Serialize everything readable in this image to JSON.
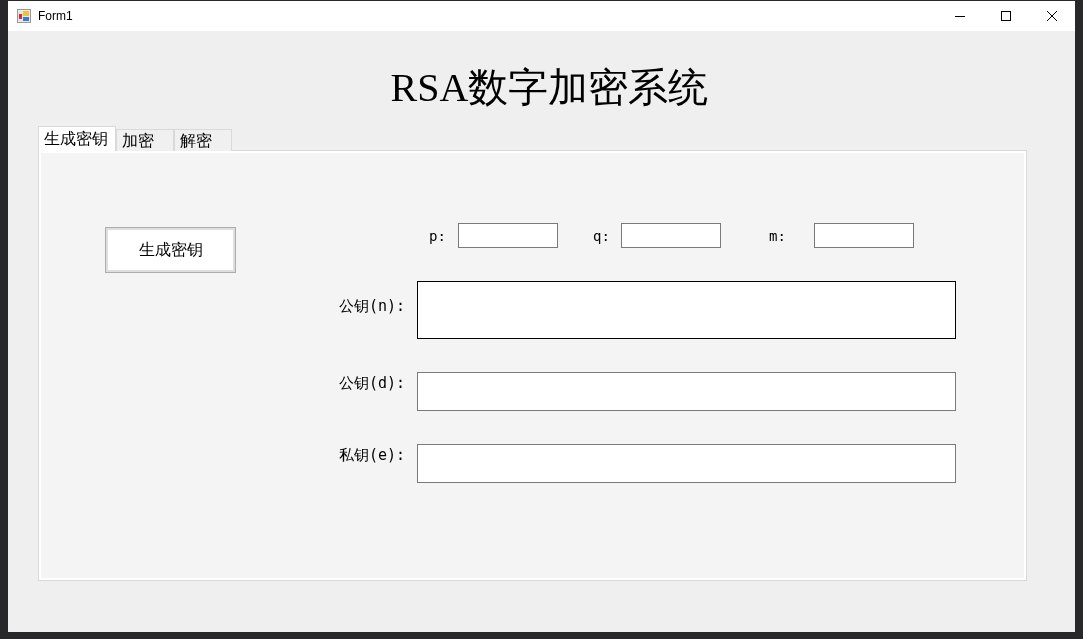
{
  "window": {
    "title": "Form1"
  },
  "heading": "RSA数字加密系统",
  "tabs": [
    {
      "label": "生成密钥",
      "selected": true
    },
    {
      "label": "加密",
      "selected": false
    },
    {
      "label": "解密",
      "selected": false
    }
  ],
  "generate_button": "生成密钥",
  "parameters": [
    {
      "label": "p:"
    },
    {
      "label": "q:"
    },
    {
      "label": "m:"
    }
  ],
  "keys": [
    {
      "label": "公钥(n):",
      "kind": "multiline",
      "focused": true
    },
    {
      "label": "公钥(d):",
      "kind": "single",
      "focused": false
    },
    {
      "label": "私钥(e):",
      "kind": "single",
      "focused": false
    }
  ]
}
